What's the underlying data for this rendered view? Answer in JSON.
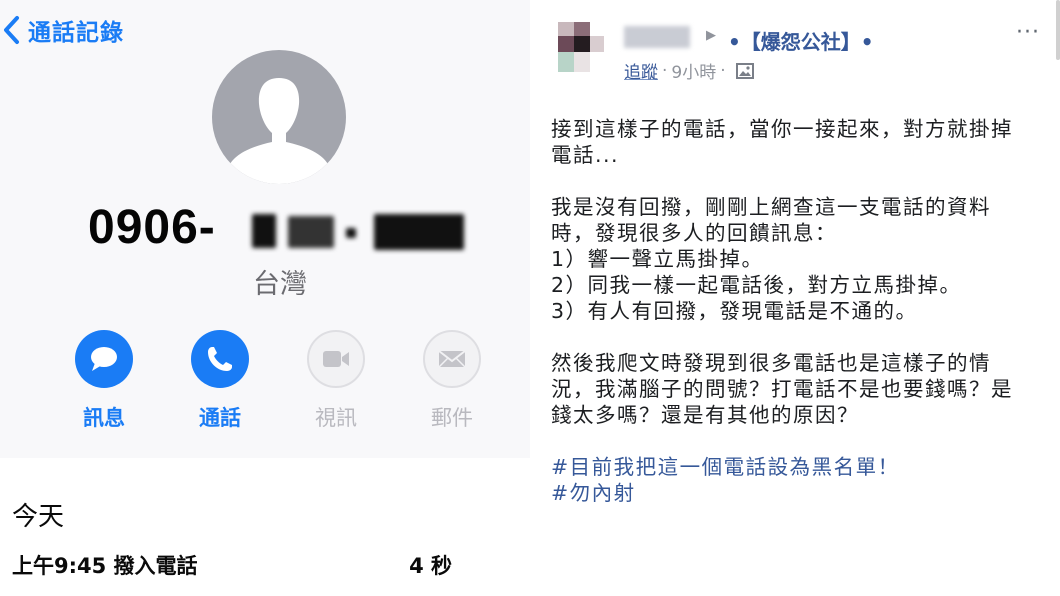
{
  "contact_card": {
    "back_label": "通話記錄",
    "phone_prefix": "0906-",
    "region": "台灣",
    "actions": [
      {
        "label": "訊息",
        "icon": "message-bubble-icon",
        "enabled": true
      },
      {
        "label": "通話",
        "icon": "phone-handset-icon",
        "enabled": true
      },
      {
        "label": "視訊",
        "icon": "video-camera-icon",
        "enabled": false
      },
      {
        "label": "郵件",
        "icon": "envelope-icon",
        "enabled": false
      }
    ],
    "accent_color": "#1a7cf5"
  },
  "call_log": {
    "section_title": "今天",
    "entries": [
      {
        "time": "上午9:45 撥入電話",
        "duration": "4 秒"
      }
    ]
  },
  "post": {
    "group": "•【爆怨公社】•",
    "meta_link": "追蹤",
    "meta_time": "9小時",
    "meta_sep": "·",
    "more_label": "···",
    "paragraphs": [
      [
        "接到這樣子的電話，當你一接起來，對方就掛掉",
        "電話..."
      ],
      [
        "我是沒有回撥，剛剛上網查這一支電話的資料",
        "時，發現很多人的回饋訊息：",
        "1）響一聲立馬掛掉。",
        "2）同我一樣一起電話後，對方立馬掛掉。",
        "3）有人有回撥，發現電話是不通的。"
      ],
      [
        "然後我爬文時發現到很多電話也是這樣子的情",
        "況，我滿腦子的問號？打電話不是也要錢嗎？是",
        "錢太多嗎？還是有其他的原因？"
      ]
    ],
    "hashtags": [
      "#目前我把這一個電話設為黑名單！",
      "#勿內射"
    ],
    "link_color": "#365899"
  }
}
